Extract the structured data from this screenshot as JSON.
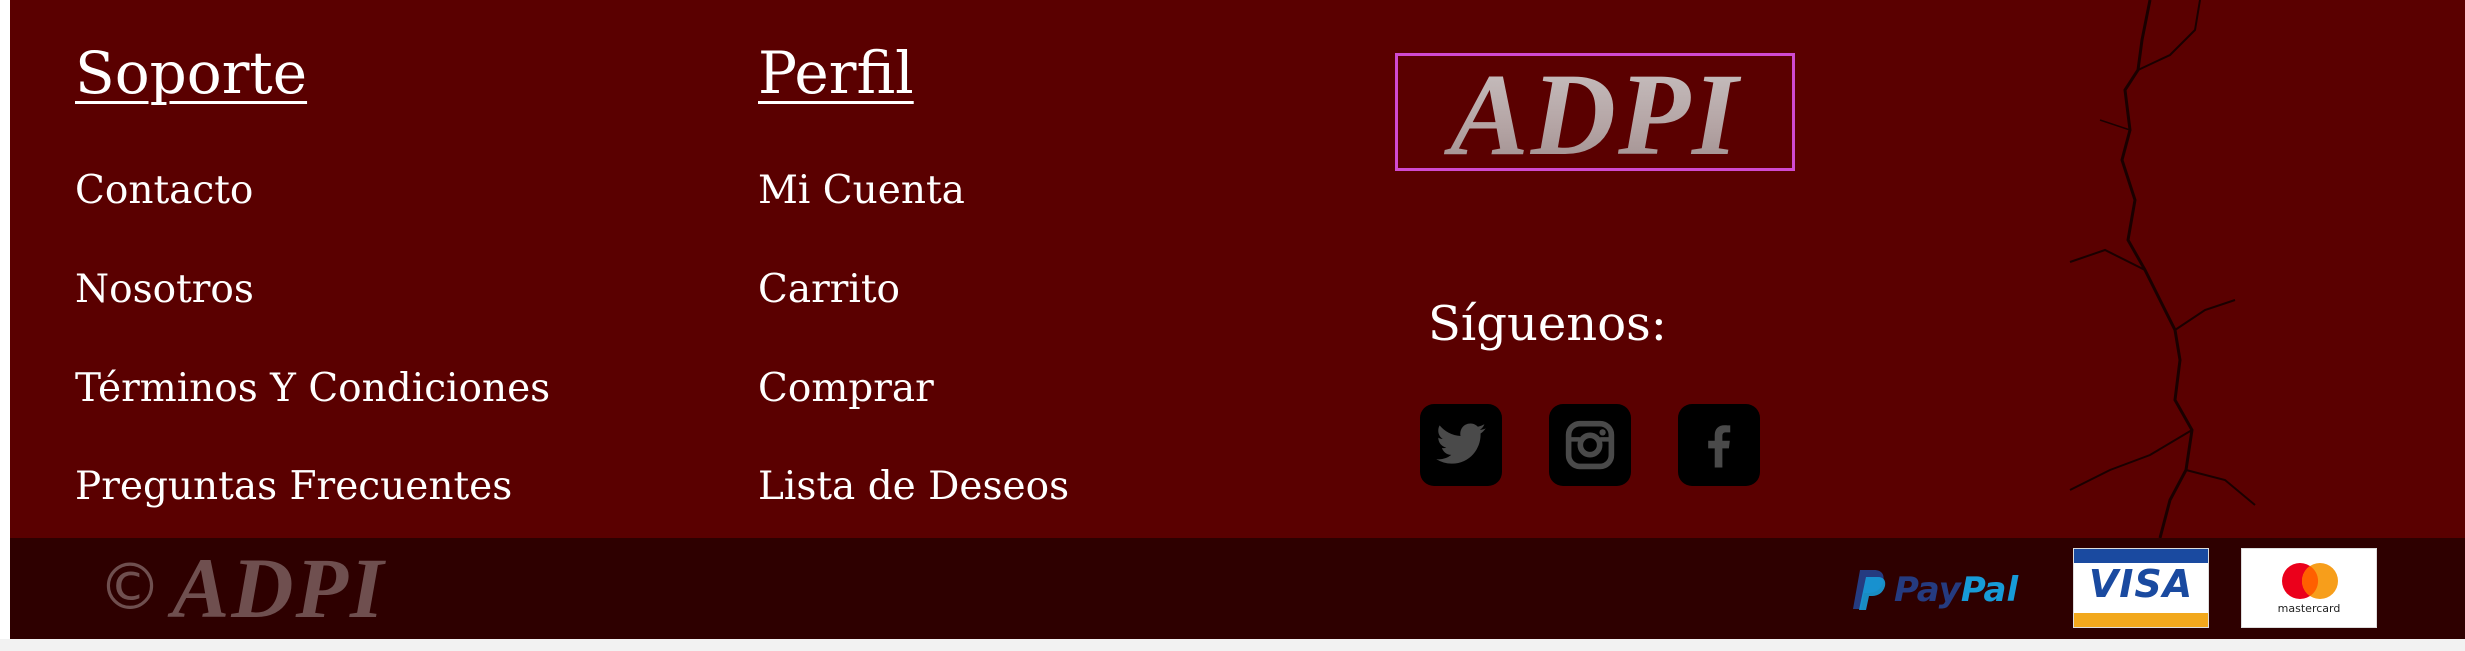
{
  "support": {
    "title": "Soporte",
    "links": [
      "Contacto",
      "Nosotros",
      "Términos Y Condiciones",
      "Preguntas Frecuentes"
    ]
  },
  "profile": {
    "title": "Perfil",
    "links": [
      "Mi Cuenta",
      "Carrito",
      "Comprar",
      "Lista de Deseos"
    ]
  },
  "brand": {
    "logo_text": "ADPI",
    "follow_label": "Síguenos:",
    "social_icons": [
      "twitter-icon",
      "instagram-icon",
      "facebook-icon"
    ]
  },
  "bottom": {
    "copyright_symbol": "©",
    "copyright_brand": "ADPI",
    "payments": {
      "paypal_pay": "Pay",
      "paypal_pal": "Pal",
      "visa": "VISA",
      "mastercard": "mastercard"
    }
  },
  "colors": {
    "footer_bg": "#5a0000",
    "bottom_bar_bg": "#2e0000",
    "logo_border": "#d04ad0",
    "text": "#ffffff"
  }
}
